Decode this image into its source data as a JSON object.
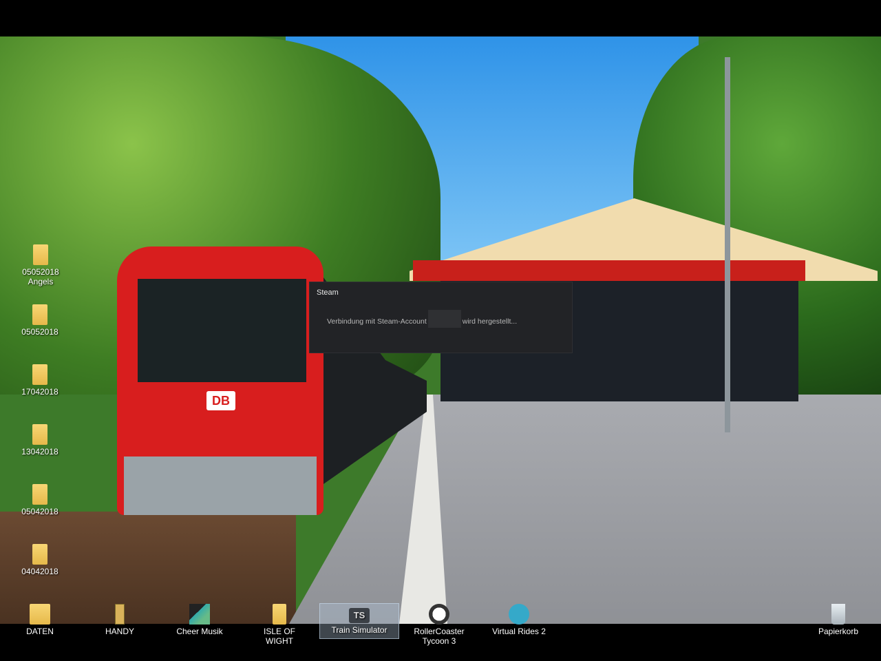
{
  "wallpaper": {
    "train_badge": "DB"
  },
  "desktop_icons_left": [
    {
      "label": "05052018 Angels",
      "icon": "folder-icon"
    },
    {
      "label": "05052018",
      "icon": "folder-icon"
    },
    {
      "label": "17042018",
      "icon": "folder-icon"
    },
    {
      "label": "13042018",
      "icon": "folder-icon"
    },
    {
      "label": "05042018",
      "icon": "folder-icon"
    },
    {
      "label": "04042018",
      "icon": "folder-icon"
    }
  ],
  "desktop_icons_bottom": [
    {
      "label": "DATEN",
      "icon": "folder-icon"
    },
    {
      "label": "HANDY",
      "icon": "phone-folder-icon"
    },
    {
      "label": "Cheer Musik",
      "icon": "music-folder-icon"
    },
    {
      "label": "ISLE OF WIGHT",
      "icon": "folder-icon"
    },
    {
      "label": "Train Simulator",
      "icon": "train-simulator-icon"
    },
    {
      "label": "RollerCoaster Tycoon 3",
      "icon": "rollercoaster-icon"
    },
    {
      "label": "Virtual Rides 2",
      "icon": "virtual-rides-icon"
    },
    {
      "label": "Papierkorb",
      "icon": "recycle-bin-icon"
    }
  ],
  "dialog": {
    "title": "Steam",
    "message_before": "Verbindung mit Steam-Account",
    "message_after": "wird hergestellt..."
  }
}
